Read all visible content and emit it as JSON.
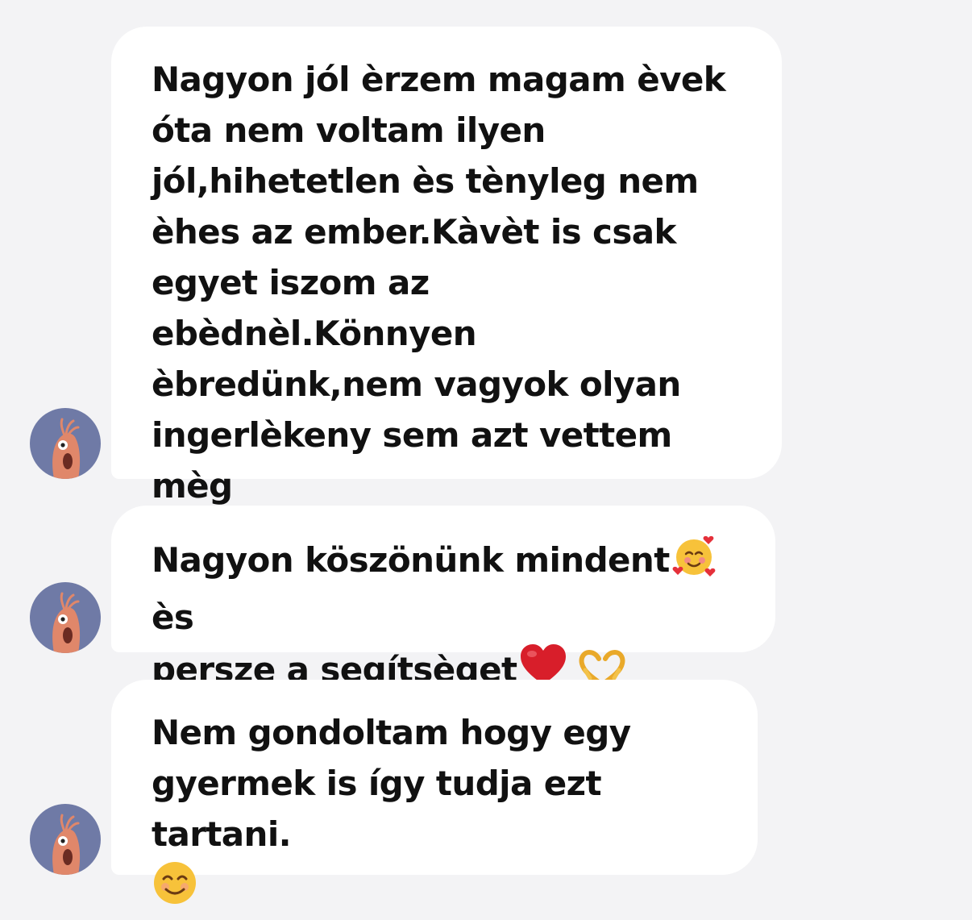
{
  "messages": [
    {
      "text": "Nagyon jól èrzem magam èvek\nóta nem voltam ilyen\njól,hihetetlen ès tènyleg nem\nèhes az ember.Kàvèt is csak\negyet iszom az ebèdnèl.Könnyen\nèbredünk,nem vagyok olyan\ningerlèkeny sem azt vettem mèg\nèszre.",
      "avatar_icon": "shrimp-mascot-avatar-icon"
    },
    {
      "text_line1": "Nagyon köszönünk mindent",
      "emoji1": "smiling-face-with-hearts-icon",
      "text_line1_end": "ès",
      "text_line2": "persze a segítsèget",
      "emoji2": "red-heart-icon",
      "emoji3": "heart-hands-icon",
      "avatar_icon": "shrimp-mascot-avatar-icon"
    },
    {
      "text": "Nem gondoltam hogy egy\ngyermek is így tudja ezt tartani.",
      "emoji": "smiling-face-icon",
      "avatar_icon": "shrimp-mascot-avatar-icon"
    }
  ],
  "colors": {
    "background": "#f3f3f5",
    "bubble": "#ffffff",
    "text": "#111111",
    "avatar_bg": "#6f7aa6",
    "avatar_figure": "#e0876a"
  }
}
